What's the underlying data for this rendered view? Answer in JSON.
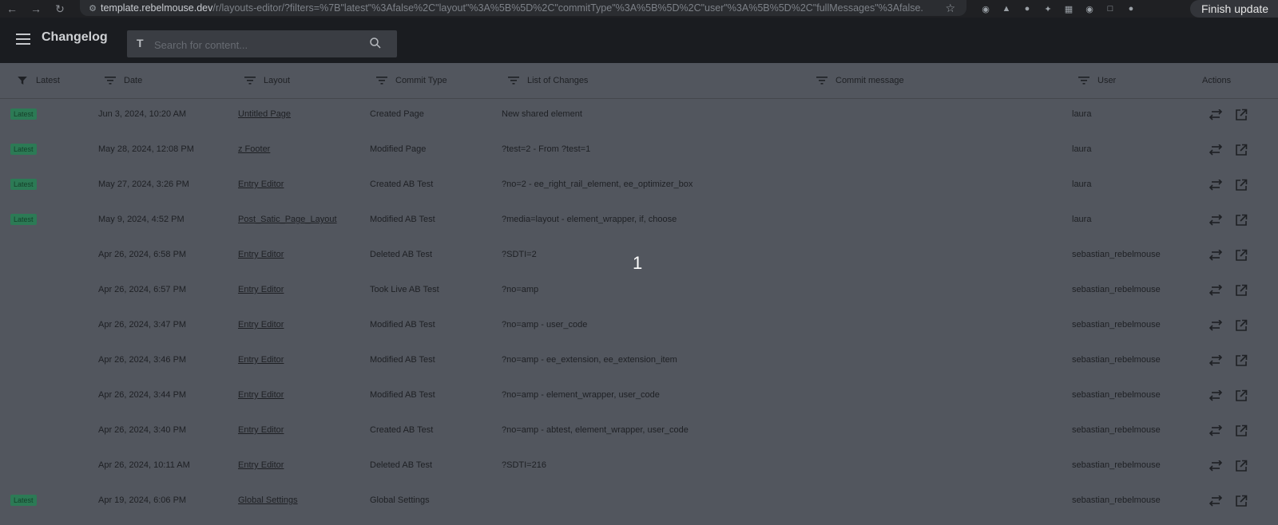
{
  "browser": {
    "url_host": "template.rebelmouse.dev",
    "url_rest": "/r/layouts-editor/?filters=%7B\"latest\"%3Afalse%2C\"layout\"%3A%5B%5D%2C\"commitType\"%3A%5B%5D%2C\"user\"%3A%5B%5D%2C\"fullMessages\"%3Afalse...",
    "finish_update": "Finish update"
  },
  "header": {
    "title": "Changelog",
    "search_placeholder": "Search for content..."
  },
  "columns": [
    "Latest",
    "Date",
    "Layout",
    "Commit Type",
    "List of Changes",
    "Commit message",
    "User",
    "Actions"
  ],
  "rows": [
    {
      "latest": "Latest",
      "date": "Jun 3, 2024, 10:20 AM",
      "layout": "Untitled Page",
      "commit_type": "Created Page",
      "changes": "New shared element",
      "message": "",
      "user": "laura"
    },
    {
      "latest": "Latest",
      "date": "May 28, 2024, 12:08 PM",
      "layout": "z Footer",
      "commit_type": "Modified Page",
      "changes": "?test=2 - From ?test=1",
      "message": "",
      "user": "laura"
    },
    {
      "latest": "Latest",
      "date": "May 27, 2024, 3:26 PM",
      "layout": "Entry Editor",
      "commit_type": "Created AB Test",
      "changes": "?no=2 - ee_right_rail_element, ee_optimizer_box",
      "message": "",
      "user": "laura"
    },
    {
      "latest": "Latest",
      "date": "May 9, 2024, 4:52 PM",
      "layout": "Post_Satic_Page_Layout",
      "commit_type": "Modified AB Test",
      "changes": "?media=layout - element_wrapper, if, choose",
      "message": "",
      "user": "laura"
    },
    {
      "latest": "",
      "date": "Apr 26, 2024, 6:58 PM",
      "layout": "Entry Editor",
      "commit_type": "Deleted AB Test",
      "changes": "?SDTI=2",
      "message": "",
      "user": "sebastian_rebelmouse"
    },
    {
      "latest": "",
      "date": "Apr 26, 2024, 6:57 PM",
      "layout": "Entry Editor",
      "commit_type": "Took Live AB Test",
      "changes": "?no=amp",
      "message": "",
      "user": "sebastian_rebelmouse"
    },
    {
      "latest": "",
      "date": "Apr 26, 2024, 3:47 PM",
      "layout": "Entry Editor",
      "commit_type": "Modified AB Test",
      "changes": "?no=amp - user_code",
      "message": "",
      "user": "sebastian_rebelmouse"
    },
    {
      "latest": "",
      "date": "Apr 26, 2024, 3:46 PM",
      "layout": "Entry Editor",
      "commit_type": "Modified AB Test",
      "changes": "?no=amp - ee_extension, ee_extension_item",
      "message": "",
      "user": "sebastian_rebelmouse"
    },
    {
      "latest": "",
      "date": "Apr 26, 2024, 3:44 PM",
      "layout": "Entry Editor",
      "commit_type": "Modified AB Test",
      "changes": "?no=amp - element_wrapper, user_code",
      "message": "",
      "user": "sebastian_rebelmouse"
    },
    {
      "latest": "",
      "date": "Apr 26, 2024, 3:40 PM",
      "layout": "Entry Editor",
      "commit_type": "Created AB Test",
      "changes": "?no=amp - abtest, element_wrapper, user_code",
      "message": "",
      "user": "sebastian_rebelmouse"
    },
    {
      "latest": "",
      "date": "Apr 26, 2024, 10:11 AM",
      "layout": "Entry Editor",
      "commit_type": "Deleted AB Test",
      "changes": "?SDTI=216",
      "message": "",
      "user": "sebastian_rebelmouse"
    },
    {
      "latest": "Latest",
      "date": "Apr 19, 2024, 6:06 PM",
      "layout": "Global Settings",
      "commit_type": "Global Settings",
      "changes": "",
      "message": "",
      "user": "sebastian_rebelmouse"
    }
  ],
  "overlay_marker": "1",
  "colors": {
    "badge": "#2c7a55",
    "overlay": "#52565e",
    "header": "#1a1c20"
  }
}
